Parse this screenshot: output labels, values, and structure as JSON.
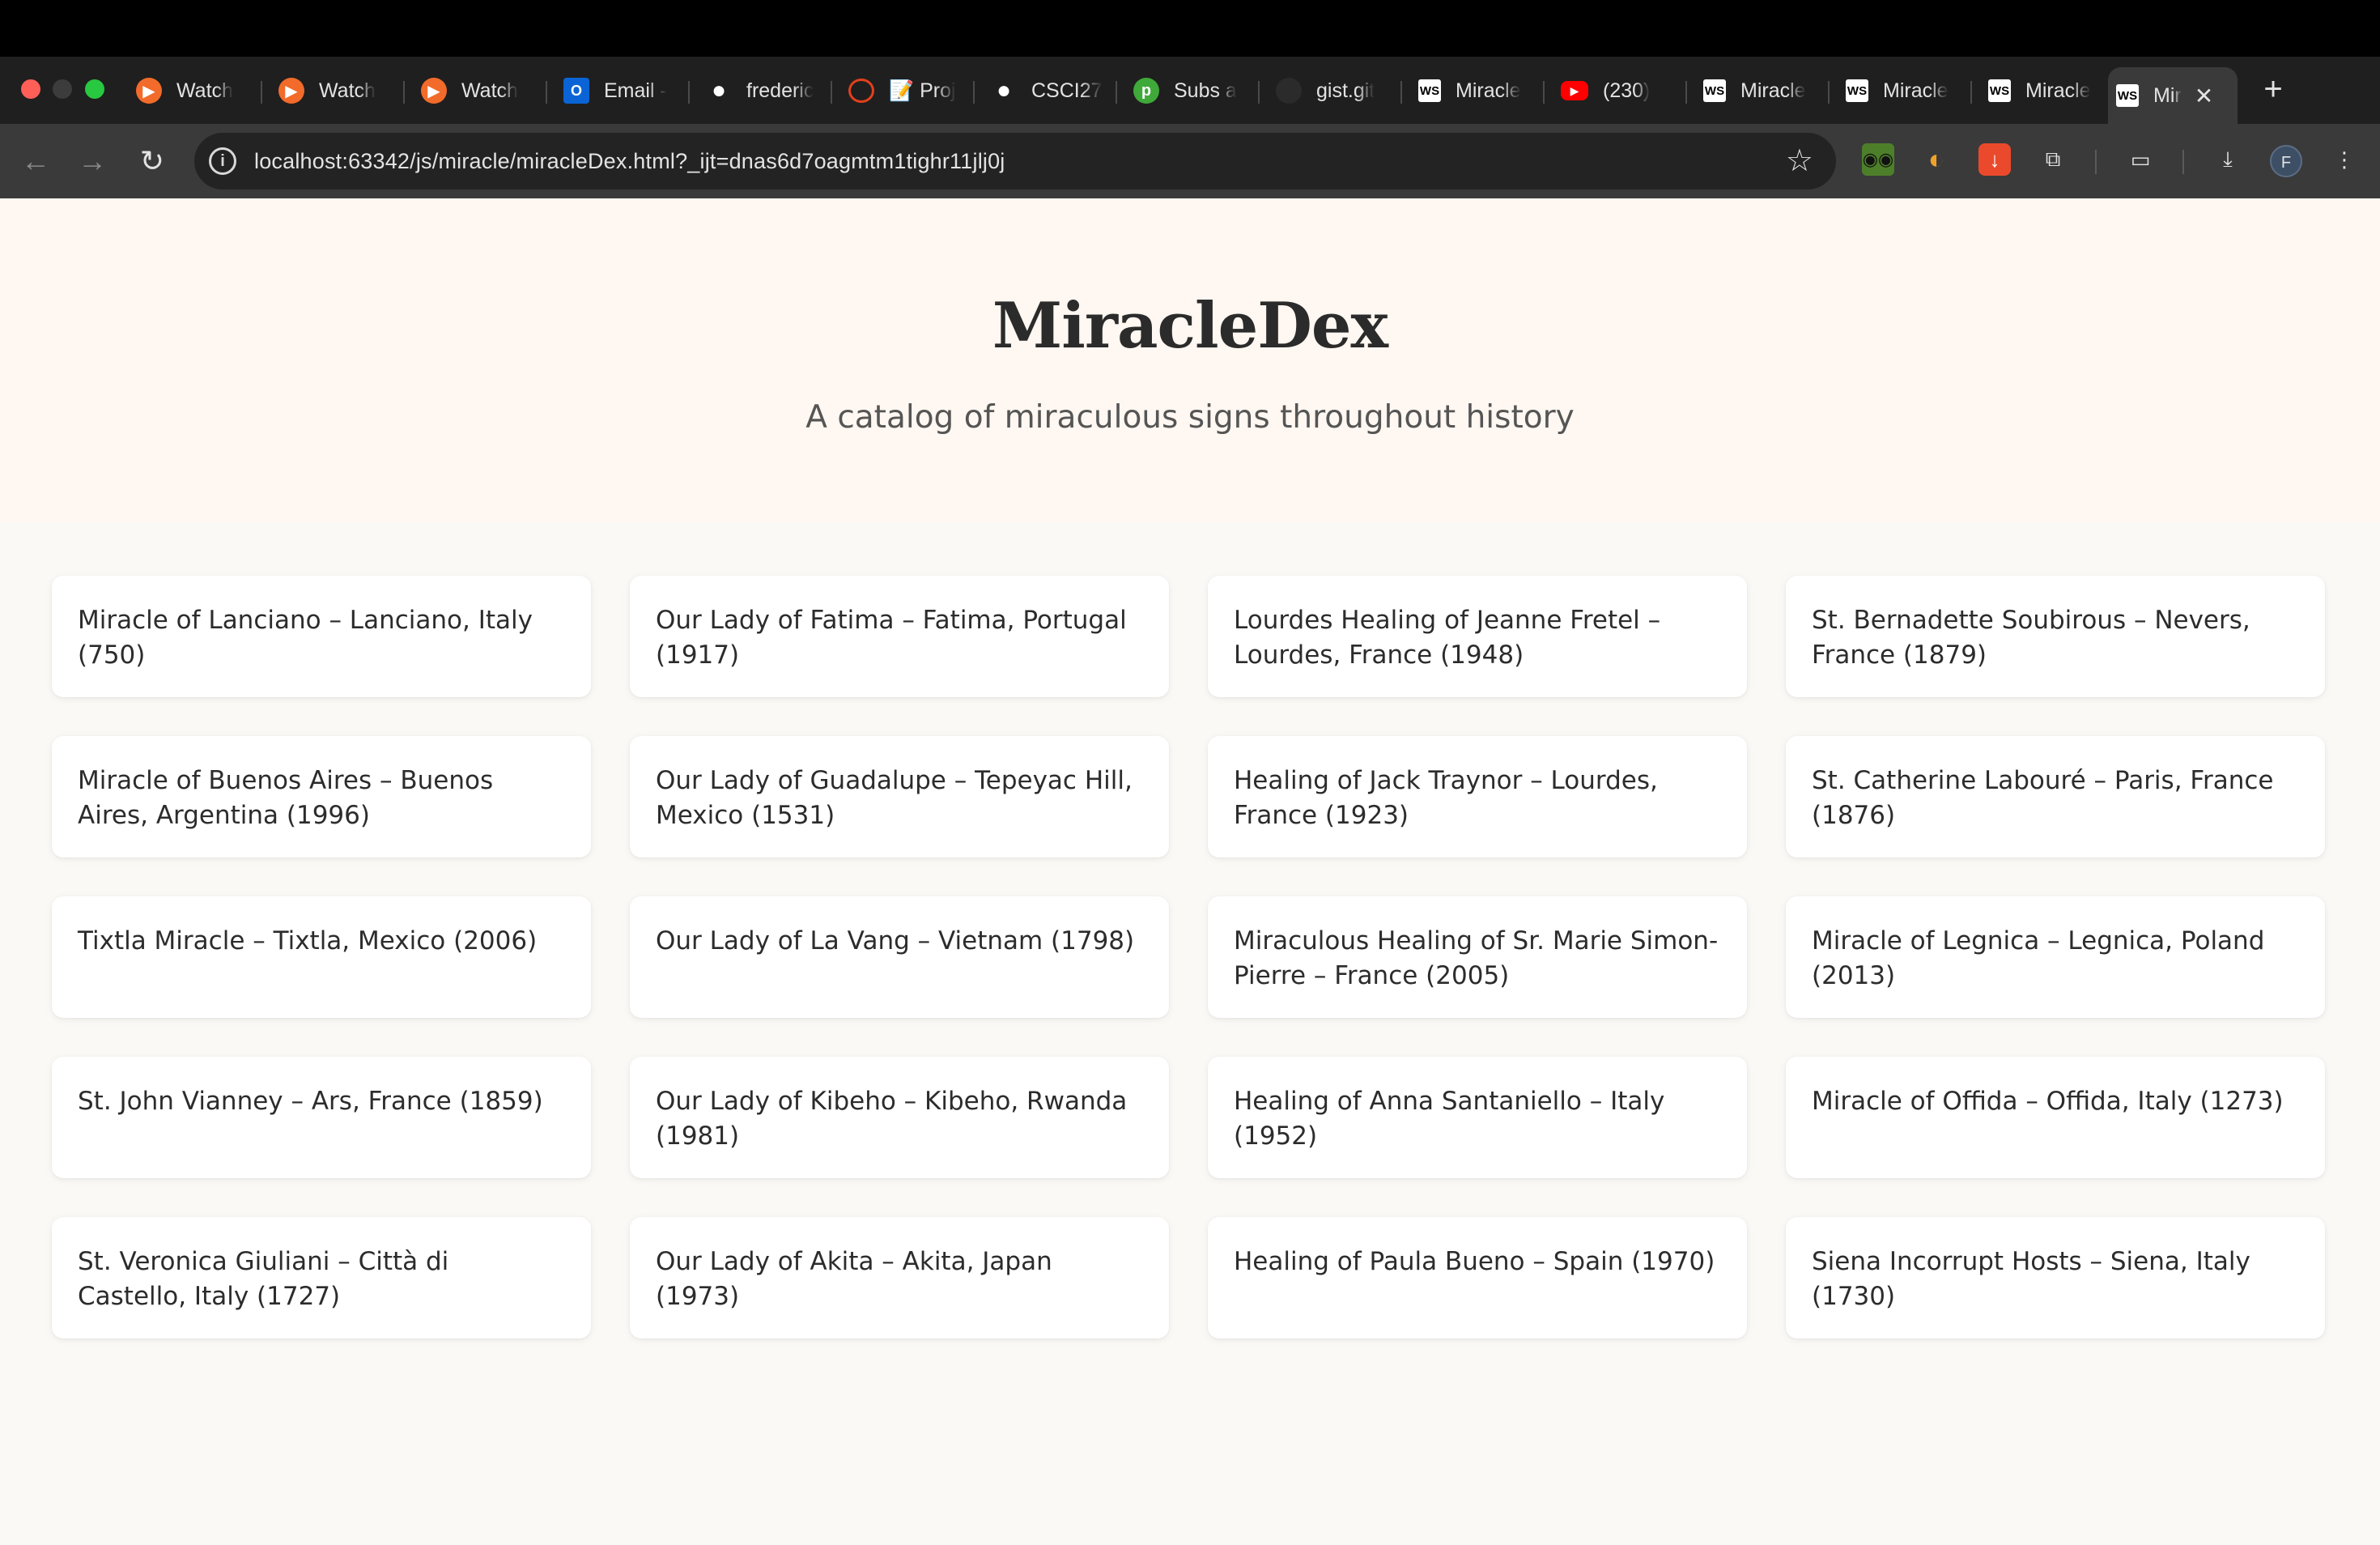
{
  "browser": {
    "tabs": [
      {
        "label": "Watch",
        "icon": "play-icon"
      },
      {
        "label": "Watch",
        "icon": "play-icon"
      },
      {
        "label": "Watch",
        "icon": "play-icon"
      },
      {
        "label": "Email -",
        "icon": "outlook-icon"
      },
      {
        "label": "frederic",
        "icon": "github-icon"
      },
      {
        "label": "📝 Proj",
        "icon": "sun-icon"
      },
      {
        "label": "CSCI27",
        "icon": "github-icon"
      },
      {
        "label": "Subs a",
        "icon": "p-icon"
      },
      {
        "label": "gist.git",
        "icon": "github-icon"
      },
      {
        "label": "Miracle",
        "icon": "webstorm-icon"
      },
      {
        "label": "(230)",
        "icon": "youtube-icon"
      },
      {
        "label": "Miracle",
        "icon": "webstorm-icon"
      },
      {
        "label": "Miracle",
        "icon": "webstorm-icon"
      },
      {
        "label": "Miracle",
        "icon": "webstorm-icon"
      },
      {
        "label": "Mir",
        "icon": "webstorm-icon"
      }
    ],
    "url": "localhost:63342/js/miracle/miracleDex.html?_ijt=dnas6d7oagmtm1tighr11jlj0j",
    "profile_initial": "F"
  },
  "page": {
    "title": "MiracleDex",
    "subtitle": "A catalog of miraculous signs throughout history",
    "miracles": [
      "Miracle of Lanciano – Lanciano, Italy (750)",
      "Our Lady of Fatima – Fatima, Portugal (1917)",
      "Lourdes Healing of Jeanne Fretel – Lourdes, France (1948)",
      "St. Bernadette Soubirous – Nevers, France (1879)",
      "Miracle of Buenos Aires – Buenos Aires, Argentina (1996)",
      "Our Lady of Guadalupe – Tepeyac Hill, Mexico (1531)",
      "Healing of Jack Traynor – Lourdes, France (1923)",
      "St. Catherine Labouré – Paris, France (1876)",
      "Tixtla Miracle – Tixtla, Mexico (2006)",
      "Our Lady of La Vang – Vietnam (1798)",
      "Miraculous Healing of Sr. Marie Simon-Pierre – France (2005)",
      "Miracle of Legnica – Legnica, Poland (2013)",
      "St. John Vianney – Ars, France (1859)",
      "Our Lady of Kibeho – Kibeho, Rwanda (1981)",
      "Healing of Anna Santaniello – Italy (1952)",
      "Miracle of Offida – Offida, Italy (1273)",
      "St. Veronica Giuliani – Città di Castello, Italy (1727)",
      "Our Lady of Akita – Akita, Japan (1973)",
      "Healing of Paula Bueno – Spain (1970)",
      "Siena Incorrupt Hosts – Siena, Italy (1730)"
    ]
  }
}
